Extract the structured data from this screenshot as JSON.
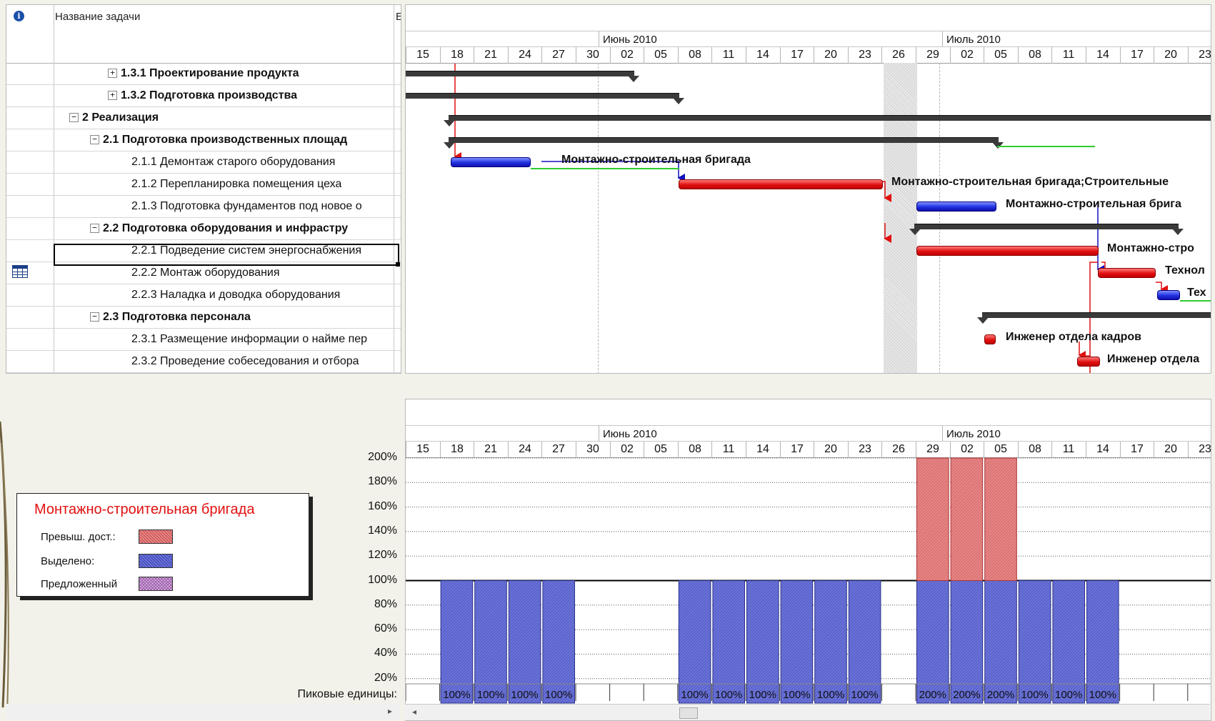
{
  "table": {
    "header_name": "Название задачи",
    "header_col2": "Е",
    "rows": [
      {
        "name": "1.3.1 Проектирование продукта",
        "bold": true,
        "toggle": "+"
      },
      {
        "name": "1.3.2 Подготовка производства",
        "bold": true,
        "toggle": "+"
      },
      {
        "name": "2 Реализация",
        "bold": true,
        "toggle": "−"
      },
      {
        "name": "2.1 Подготовка производственных площад",
        "bold": true,
        "toggle": "−"
      },
      {
        "name": "2.1.1 Демонтаж старого оборудования",
        "bold": false,
        "toggle": ""
      },
      {
        "name": "2.1.2 Перепланировка помещения цеха",
        "bold": false,
        "toggle": ""
      },
      {
        "name": "2.1.3 Подготовка фундаментов под новое о",
        "bold": false,
        "toggle": ""
      },
      {
        "name": "2.2 Подготовка оборудования и инфрастру",
        "bold": true,
        "toggle": "−"
      },
      {
        "name": "2.2.1 Подведение систем энергоснабжения",
        "bold": false,
        "toggle": ""
      },
      {
        "name": "2.2.2 Монтаж оборудования",
        "bold": false,
        "toggle": "",
        "indicator": "calendar-icon"
      },
      {
        "name": "2.2.3 Наладка и доводка оборудования",
        "bold": false,
        "toggle": ""
      },
      {
        "name": "2.3 Подготовка персонала",
        "bold": true,
        "toggle": "−"
      },
      {
        "name": "2.3.1 Размещение информации о найме пер",
        "bold": false,
        "toggle": ""
      },
      {
        "name": "2.3.2 Проведение собеседования и отбора",
        "bold": false,
        "toggle": ""
      }
    ]
  },
  "timescale": {
    "months": [
      "Июнь 2010",
      "Июль 2010"
    ],
    "days": [
      "15",
      "18",
      "21",
      "24",
      "27",
      "30",
      "02",
      "05",
      "08",
      "11",
      "14",
      "17",
      "20",
      "23",
      "26",
      "29",
      "02",
      "05",
      "08",
      "11",
      "14",
      "17",
      "20",
      "23"
    ]
  },
  "gantt_labels": {
    "r4": "Монтажно-строительная бригада",
    "r5": "Монтажно-строительная бригада;Строительные",
    "r6": "Монтажно-строительная брига",
    "r8": "Монтажно-стро",
    "r9": "Технол",
    "r10": "Тех",
    "r12": "Инженер отдела кадров",
    "r13": "Инженер отдела"
  },
  "legend": {
    "title": "Монтажно-строительная бригада",
    "overallocated": "Превыш. дост.:",
    "allocated": "Выделено:",
    "proposed": "Предложенный"
  },
  "colors": {
    "overallocated": "#e58787",
    "allocated": "#6b74d8",
    "proposed": "#d9b7e3",
    "legend_title": "#e01010"
  },
  "peak_label": "Пиковые единицы:",
  "chart_data": {
    "type": "bar",
    "title": "",
    "ylabel": "",
    "ylim": [
      0,
      200
    ],
    "yticks": [
      "200%",
      "180%",
      "160%",
      "140%",
      "120%",
      "100%",
      "80%",
      "60%",
      "40%",
      "20%"
    ],
    "x_start_day": "15",
    "series": [
      {
        "name": "Выделено:",
        "values": [
          0,
          100,
          100,
          100,
          100,
          0,
          0,
          0,
          100,
          100,
          100,
          100,
          100,
          100,
          0,
          100,
          100,
          100,
          100,
          100,
          100,
          0,
          0,
          0
        ]
      },
      {
        "name": "Превыш. дост.:",
        "values": [
          0,
          0,
          0,
          0,
          0,
          0,
          0,
          0,
          0,
          0,
          0,
          0,
          0,
          0,
          0,
          100,
          100,
          100,
          0,
          0,
          0,
          0,
          0,
          0
        ]
      }
    ],
    "peak_units": [
      "",
      "100%",
      "100%",
      "100%",
      "100%",
      "",
      "",
      "",
      "100%",
      "100%",
      "100%",
      "100%",
      "100%",
      "100%",
      "",
      "200%",
      "200%",
      "200%",
      "100%",
      "100%",
      "100%",
      "",
      "",
      ""
    ]
  }
}
